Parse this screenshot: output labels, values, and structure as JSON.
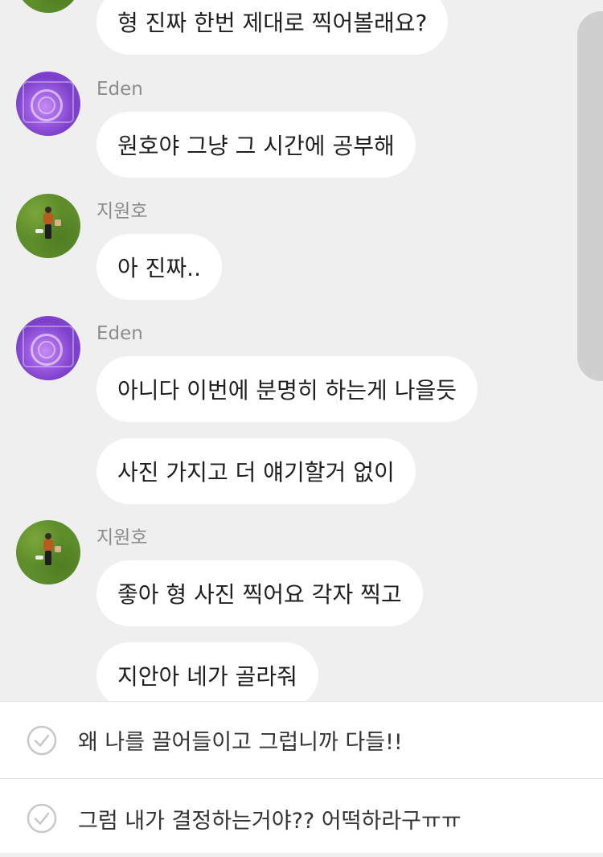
{
  "messages": [
    {
      "sender": "",
      "text": "형 진짜 한번 제대로 찍어볼래요?"
    },
    {
      "sender": "Eden",
      "text": "원호야 그냥 그 시간에 공부해"
    },
    {
      "sender": "지원호",
      "text": "아 진짜.."
    },
    {
      "sender": "Eden",
      "text": "아니다 이번에 분명히 하는게 나을듯"
    },
    {
      "sender": "",
      "text": "사진 가지고 더 얘기할거 없이"
    },
    {
      "sender": "지원호",
      "text": "좋아 형 사진 찍어요 각자 찍고"
    },
    {
      "sender": "",
      "text": "지안아 네가 골라줘"
    }
  ],
  "replies": [
    {
      "text": "왜 나를 끌어들이고 그럽니까 다들!!"
    },
    {
      "text": "그럼 내가 결정하는거야?? 어떡하라구ㅠㅠ"
    }
  ],
  "icons": {
    "eden_avatar": "camera-avatar-icon",
    "wonho_avatar": "person-on-grass-avatar-icon",
    "reply_check": "check-circle-icon"
  },
  "colors": {
    "background": "#efeff0",
    "bubble": "#ffffff",
    "sender_name": "#8c8c8c"
  }
}
